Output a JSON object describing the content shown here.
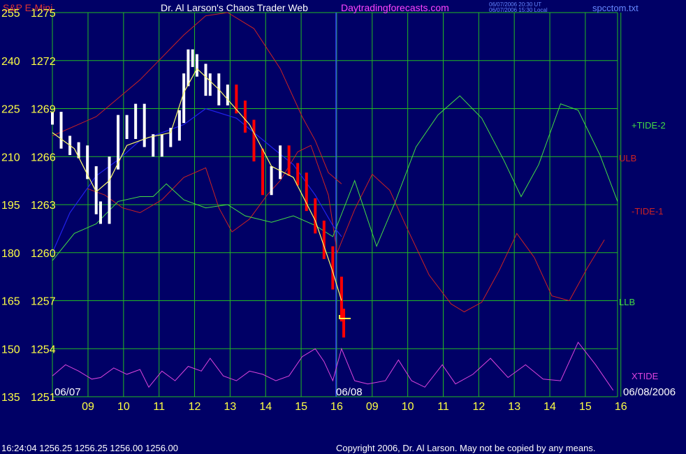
{
  "header": {
    "symbol": "S&P E-Mini",
    "title": "Dr. Al Larson's Chaos Trader Web",
    "site": "Daytradingforecasts.com",
    "stamp_ut": "06/07/2006 20:30 UT",
    "stamp_local": "06/07/2006 15:30 Local",
    "file": "spcctom.txt"
  },
  "footer": {
    "quote": "16:24:04   1256.25  1256.25  1256.00  1256.00",
    "copyright": "Copyright 2006, Dr. Al Larson. May not be copied by any means."
  },
  "colors": {
    "background": "#000066",
    "grid": "#22bb22",
    "price_bar": "#ffffff",
    "price_bar_down": "#ff0000",
    "ema": "#ffff66",
    "tide_plus": "#44dd44",
    "tide_minus": "#cc2222",
    "xtide": "#dd44dd",
    "lower_band": "#2222ee"
  },
  "chart_data": {
    "type": "line",
    "title": "S&P E-Mini",
    "ylim_price": [
      1251,
      1275
    ],
    "ylim_index": [
      135,
      255
    ],
    "y_ticks_index": [
      "255",
      "240",
      "225",
      "210",
      "195",
      "180",
      "165",
      "150",
      "135"
    ],
    "y_ticks_price": [
      "1275",
      "1272",
      "1269",
      "1266",
      "1263",
      "1260",
      "1257",
      "1254",
      "1251"
    ],
    "x_ticks": [
      "09",
      "10",
      "11",
      "12",
      "13",
      "14",
      "15",
      "16",
      "09",
      "10",
      "11",
      "12",
      "13",
      "14",
      "15",
      "16"
    ],
    "date_labels": [
      "06/07",
      "06/08",
      "06/08/2006"
    ],
    "series_labels": [
      "+TIDE-2",
      "ULB",
      "-TIDE-1",
      "LLB",
      "XTIDE"
    ],
    "price_close": [
      [
        0.0,
        1268.4
      ],
      [
        0.2,
        1266.9
      ],
      [
        0.4,
        1266.5
      ],
      [
        0.6,
        1266.3
      ],
      [
        0.8,
        1265.0
      ],
      [
        1.0,
        1262.8
      ],
      [
        1.1,
        1262.2
      ],
      [
        1.3,
        1265.6
      ],
      [
        1.5,
        1268.2
      ],
      [
        1.7,
        1267.5
      ],
      [
        1.9,
        1268.9
      ],
      [
        2.1,
        1267.0
      ],
      [
        2.3,
        1266.4
      ],
      [
        2.5,
        1267.0
      ],
      [
        2.7,
        1267.4
      ],
      [
        2.9,
        1268.5
      ],
      [
        3.0,
        1270.8
      ],
      [
        3.1,
        1272.3
      ],
      [
        3.2,
        1272.0
      ],
      [
        3.3,
        1271.4
      ],
      [
        3.5,
        1270.2
      ],
      [
        3.6,
        1270.8
      ],
      [
        3.8,
        1269.6
      ],
      [
        4.0,
        1270.1
      ],
      [
        4.2,
        1269.1
      ],
      [
        4.4,
        1267.9
      ],
      [
        4.6,
        1266.1
      ],
      [
        4.8,
        1264.0
      ],
      [
        5.0,
        1265.0
      ],
      [
        5.2,
        1266.3
      ],
      [
        5.4,
        1265.2
      ],
      [
        5.6,
        1264.6
      ],
      [
        5.8,
        1263.0
      ],
      [
        6.0,
        1261.6
      ],
      [
        6.2,
        1260.0
      ],
      [
        6.4,
        1258.1
      ],
      [
        6.6,
        1256.1
      ],
      [
        6.65,
        1255.1
      ]
    ],
    "ema": [
      [
        0.0,
        1267.5
      ],
      [
        0.5,
        1266.5
      ],
      [
        1.0,
        1263.8
      ],
      [
        1.3,
        1264.5
      ],
      [
        1.7,
        1266.7
      ],
      [
        2.2,
        1267.2
      ],
      [
        2.7,
        1267.5
      ],
      [
        3.0,
        1270.0
      ],
      [
        3.3,
        1271.5
      ],
      [
        3.8,
        1270.2
      ],
      [
        4.5,
        1268.0
      ],
      [
        5.0,
        1265.4
      ],
      [
        5.5,
        1264.7
      ],
      [
        6.0,
        1262.0
      ],
      [
        6.4,
        1258.8
      ],
      [
        6.6,
        1257.0
      ]
    ],
    "lower_band": [
      [
        0.0,
        1260.0
      ],
      [
        0.4,
        1262.5
      ],
      [
        1.0,
        1264.8
      ],
      [
        1.5,
        1265.8
      ],
      [
        2.0,
        1267.0
      ],
      [
        2.5,
        1267.5
      ],
      [
        3.0,
        1268.0
      ],
      [
        3.5,
        1269.0
      ],
      [
        4.2,
        1268.4
      ],
      [
        5.0,
        1266.6
      ],
      [
        5.5,
        1265.5
      ],
      [
        6.0,
        1263.6
      ],
      [
        6.4,
        1261.7
      ],
      [
        6.6,
        1261.0
      ]
    ],
    "upper_line": [
      [
        0.0,
        1267.3
      ],
      [
        1.0,
        1268.5
      ],
      [
        2.0,
        1270.8
      ],
      [
        3.0,
        1273.6
      ],
      [
        3.5,
        1274.8
      ],
      [
        4.0,
        1275.0
      ],
      [
        4.6,
        1274.0
      ],
      [
        5.2,
        1271.5
      ],
      [
        5.7,
        1268.5
      ],
      [
        6.0,
        1267.0
      ],
      [
        6.3,
        1265.0
      ],
      [
        6.6,
        1264.3
      ]
    ],
    "tide_plus_2": [
      [
        0.0,
        1259.5
      ],
      [
        0.5,
        1261.2
      ],
      [
        1.0,
        1261.8
      ],
      [
        1.5,
        1263.2
      ],
      [
        2.0,
        1263.5
      ],
      [
        2.3,
        1263.5
      ],
      [
        2.6,
        1264.3
      ],
      [
        3.0,
        1263.3
      ],
      [
        3.5,
        1262.8
      ],
      [
        4.0,
        1263.0
      ],
      [
        4.4,
        1262.3
      ],
      [
        5.0,
        1261.9
      ],
      [
        5.5,
        1262.3
      ],
      [
        6.0,
        1261.7
      ],
      [
        6.4,
        1261.0
      ],
      [
        6.9,
        1264.5
      ],
      [
        7.4,
        1260.4
      ],
      [
        7.8,
        1263.0
      ],
      [
        8.3,
        1266.6
      ],
      [
        8.8,
        1268.6
      ],
      [
        9.3,
        1269.8
      ],
      [
        9.8,
        1268.4
      ],
      [
        10.3,
        1265.8
      ],
      [
        10.7,
        1263.5
      ],
      [
        11.1,
        1265.5
      ],
      [
        11.6,
        1269.3
      ],
      [
        12.0,
        1268.9
      ],
      [
        12.5,
        1266.1
      ],
      [
        12.9,
        1263.2
      ]
    ],
    "tide_minus_1": [
      [
        0.8,
        1264.0
      ],
      [
        1.2,
        1263.6
      ],
      [
        1.6,
        1262.8
      ],
      [
        2.0,
        1262.5
      ],
      [
        2.5,
        1263.3
      ],
      [
        3.0,
        1264.7
      ],
      [
        3.5,
        1265.3
      ],
      [
        3.8,
        1262.8
      ],
      [
        4.1,
        1261.3
      ],
      [
        4.5,
        1262.1
      ],
      [
        4.9,
        1263.6
      ],
      [
        5.2,
        1264.5
      ],
      [
        5.6,
        1266.3
      ],
      [
        5.9,
        1266.7
      ],
      [
        6.3,
        1263.6
      ],
      [
        6.5,
        1260.0
      ],
      [
        6.9,
        1262.7
      ],
      [
        7.3,
        1264.9
      ],
      [
        7.7,
        1263.9
      ],
      [
        8.1,
        1261.5
      ],
      [
        8.6,
        1258.6
      ],
      [
        9.1,
        1256.8
      ],
      [
        9.4,
        1256.3
      ],
      [
        9.8,
        1256.9
      ],
      [
        10.2,
        1258.9
      ],
      [
        10.6,
        1261.2
      ],
      [
        11.0,
        1259.7
      ],
      [
        11.4,
        1257.3
      ],
      [
        11.8,
        1257.0
      ],
      [
        12.2,
        1259.0
      ],
      [
        12.6,
        1260.8
      ]
    ],
    "xtide": [
      [
        0.0,
        1252.3
      ],
      [
        0.3,
        1253.0
      ],
      [
        0.6,
        1252.6
      ],
      [
        0.9,
        1252.1
      ],
      [
        1.1,
        1252.2
      ],
      [
        1.4,
        1252.8
      ],
      [
        1.7,
        1252.4
      ],
      [
        2.0,
        1252.7
      ],
      [
        2.2,
        1251.6
      ],
      [
        2.5,
        1252.6
      ],
      [
        2.8,
        1252.0
      ],
      [
        3.1,
        1252.9
      ],
      [
        3.4,
        1252.6
      ],
      [
        3.6,
        1253.4
      ],
      [
        3.9,
        1252.3
      ],
      [
        4.2,
        1252.0
      ],
      [
        4.5,
        1252.6
      ],
      [
        4.8,
        1252.4
      ],
      [
        5.1,
        1252.0
      ],
      [
        5.4,
        1252.3
      ],
      [
        5.7,
        1253.5
      ],
      [
        6.0,
        1254.0
      ],
      [
        6.2,
        1253.2
      ],
      [
        6.4,
        1252.0
      ],
      [
        6.6,
        1254.0
      ],
      [
        6.9,
        1252.0
      ],
      [
        7.2,
        1251.8
      ],
      [
        7.6,
        1252.0
      ],
      [
        7.9,
        1253.3
      ],
      [
        8.2,
        1252.0
      ],
      [
        8.5,
        1251.6
      ],
      [
        8.9,
        1253.0
      ],
      [
        9.2,
        1251.8
      ],
      [
        9.6,
        1252.4
      ],
      [
        10.0,
        1253.4
      ],
      [
        10.4,
        1252.2
      ],
      [
        10.8,
        1253.0
      ],
      [
        11.2,
        1252.1
      ],
      [
        11.6,
        1252.0
      ],
      [
        12.0,
        1254.4
      ],
      [
        12.4,
        1253.0
      ],
      [
        12.8,
        1251.4
      ]
    ]
  }
}
